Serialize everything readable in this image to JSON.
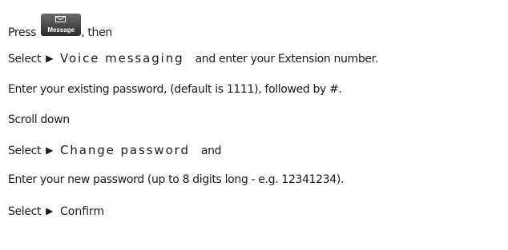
{
  "lines": {
    "line1": {
      "before": "Press",
      "key_label": "Message",
      "key_icon": "envelope-icon",
      "after": ", then"
    },
    "line2": {
      "before": "Select",
      "arrow": "▶",
      "menu": "Voice messaging",
      "after": "and enter your Extension number."
    },
    "line3": {
      "text": "Enter your existing password, (default is 1111), followed by #."
    },
    "line4": {
      "text": "Scroll down"
    },
    "line5": {
      "before": "Select",
      "arrow": "▶",
      "menu": "Change password",
      "after": "and"
    },
    "line6": {
      "text": "Enter your new password (up to 8 digits long - e.g. 12341234)."
    },
    "line7": {
      "before": "Select",
      "arrow": "▶",
      "menu": "Confirm"
    }
  }
}
